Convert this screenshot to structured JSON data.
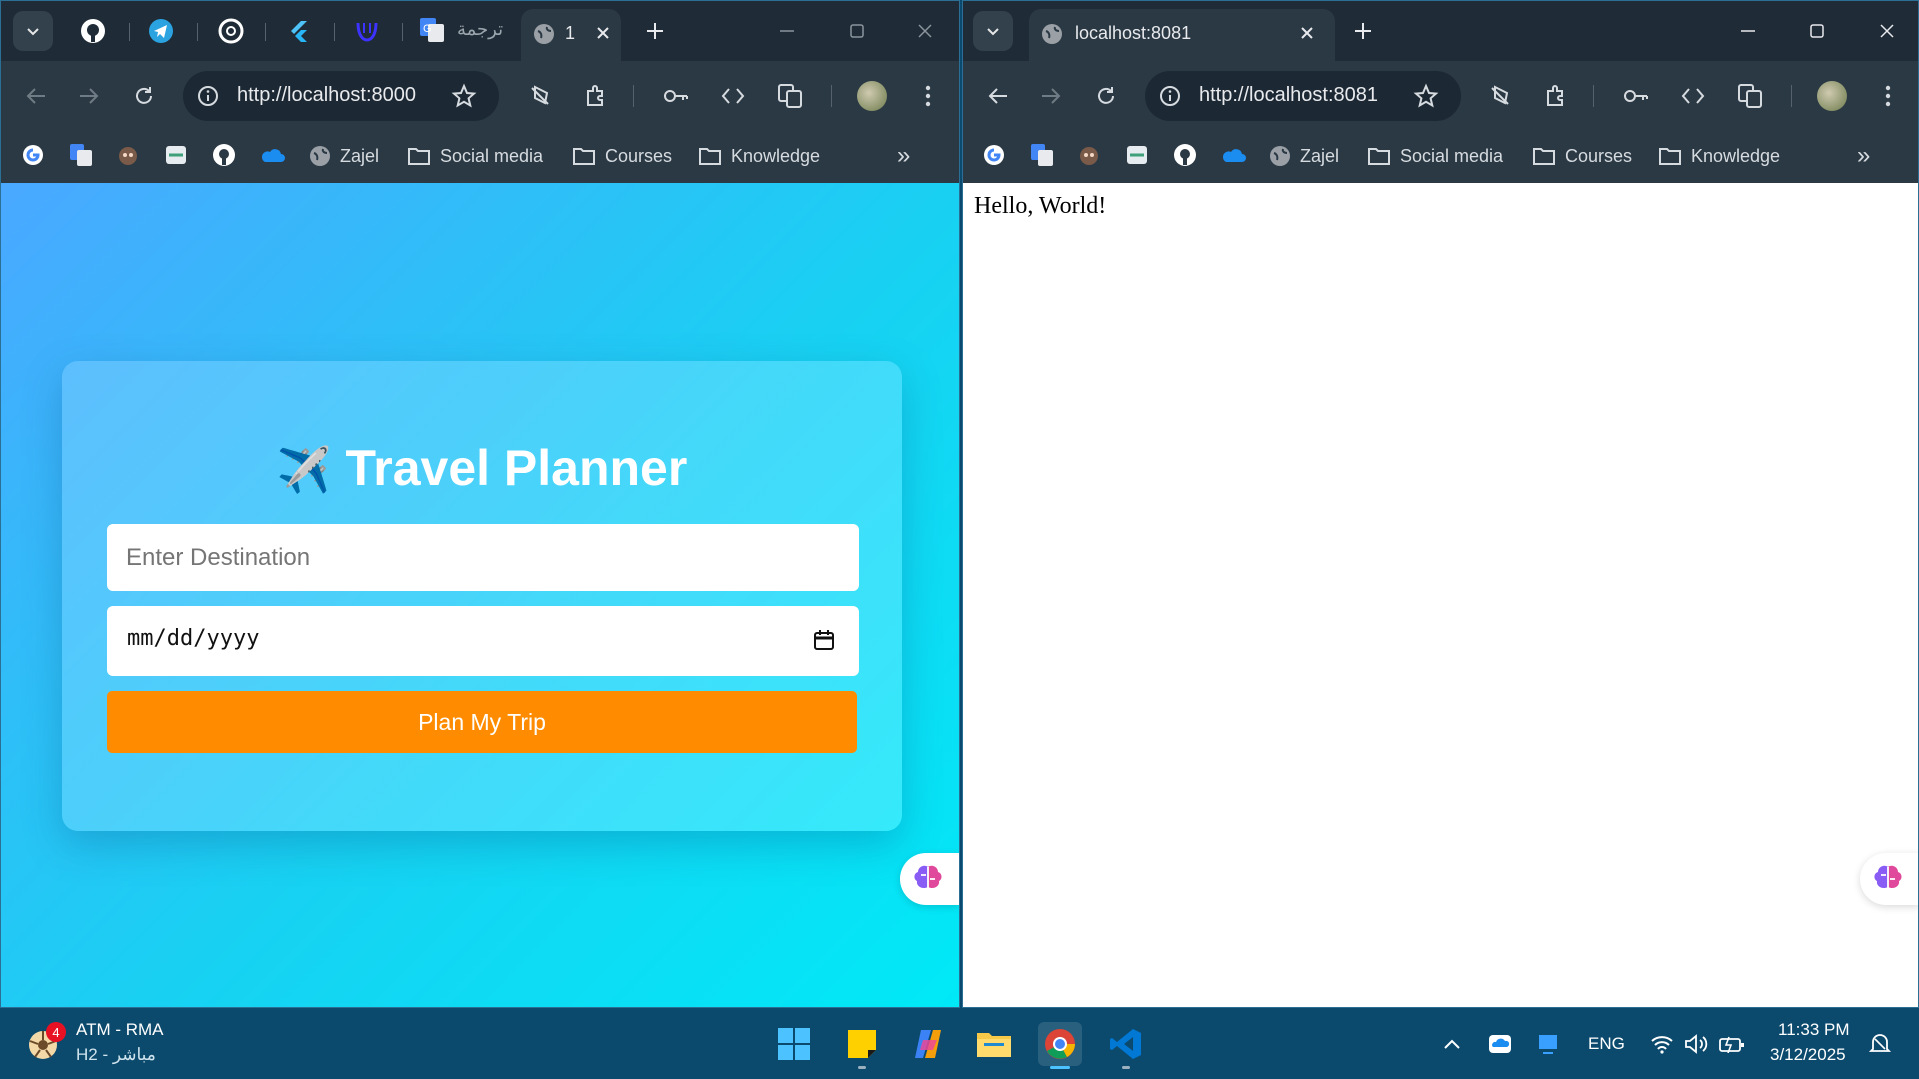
{
  "left_window": {
    "active_tab_title": "1",
    "translate_tab_title": "ترجمة",
    "url": "http://localhost:8000",
    "page": {
      "title": "Travel Planner",
      "title_icon": "✈️",
      "destination_placeholder": "Enter Destination",
      "date_placeholder": "mm/dd/yyyy",
      "button_label": "Plan My Trip"
    }
  },
  "right_window": {
    "active_tab_title": "localhost:8081",
    "url": "http://localhost:8081",
    "page": {
      "body_text": "Hello, World!"
    }
  },
  "bookmarks": {
    "zajel": "Zajel",
    "social_media": "Social media",
    "courses": "Courses",
    "knowledge": "Knowledge",
    "overflow": "»"
  },
  "taskbar": {
    "widget_title": "ATM - RMA",
    "widget_subtitle": "H2 - مباشر",
    "widget_badge": "4",
    "language": "ENG",
    "time": "11:33 PM",
    "date": "3/12/2025"
  },
  "colors": {
    "button_orange": "#ff8c00",
    "gradient_start": "#4aa8ff",
    "gradient_end": "#00e9f7",
    "taskbar": "#0c4a6d"
  }
}
